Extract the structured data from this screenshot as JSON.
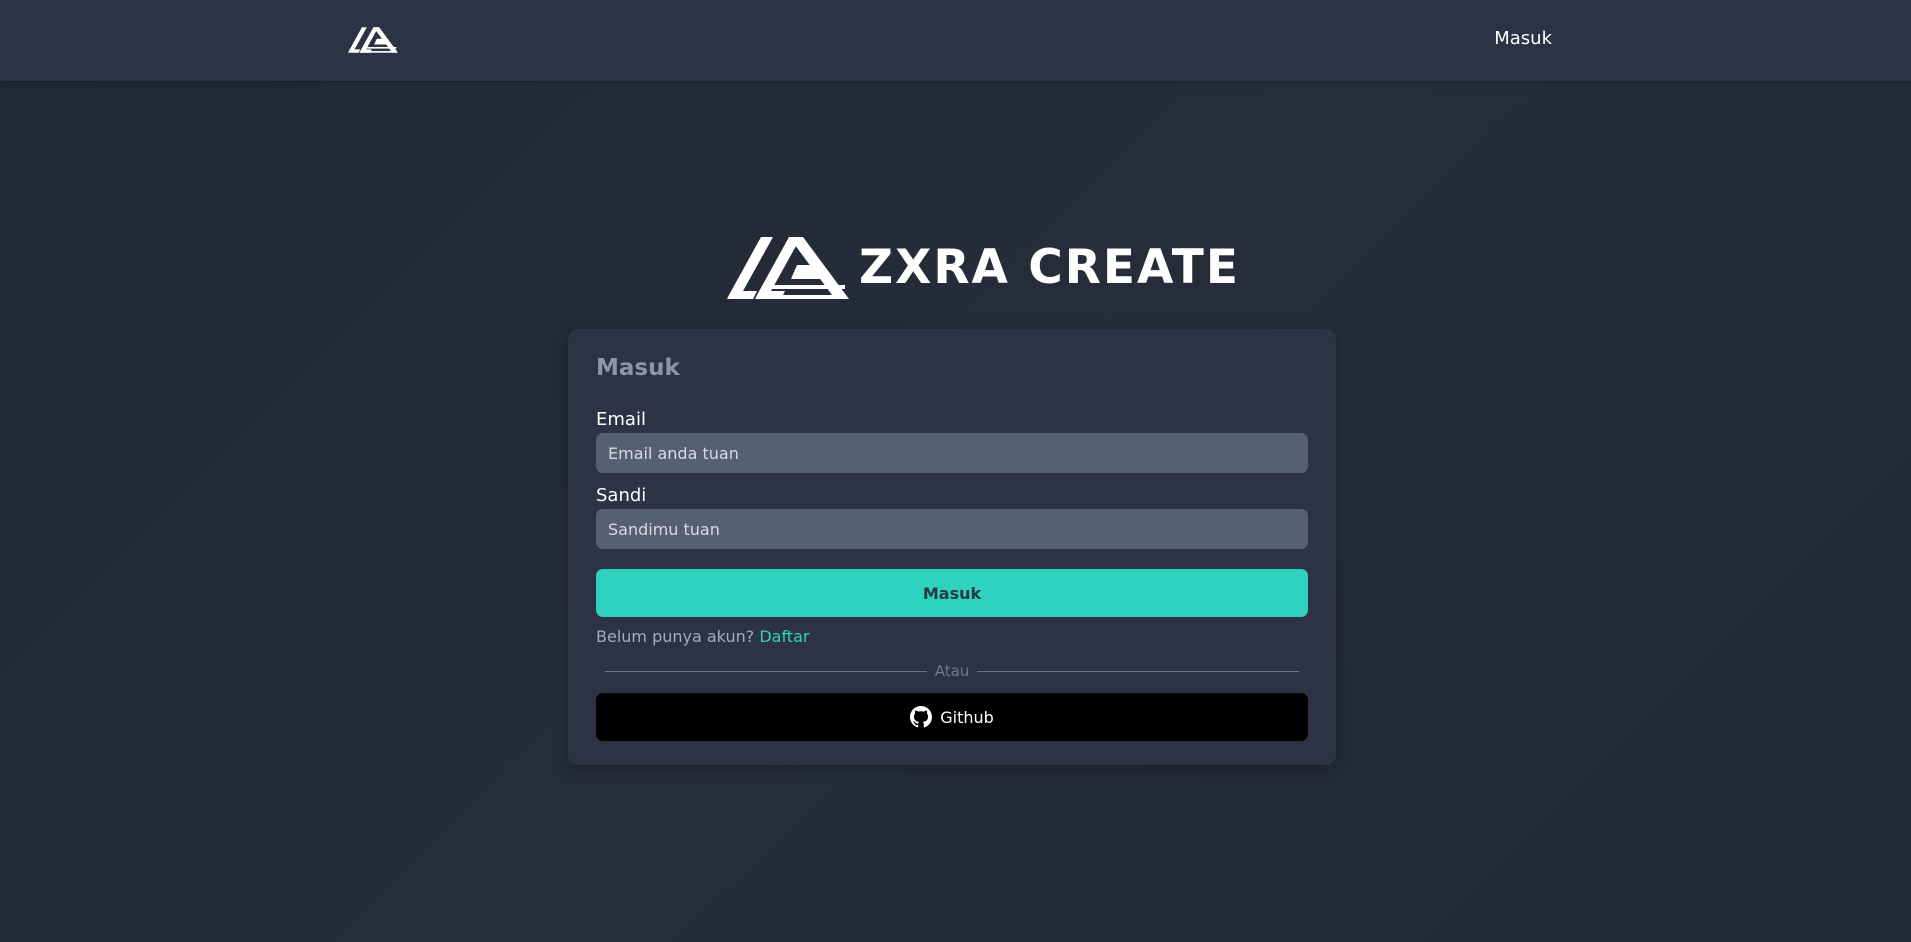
{
  "navbar": {
    "login_label": "Masuk"
  },
  "brand": {
    "name": "ZXRA CREATE"
  },
  "form": {
    "title": "Masuk",
    "email_label": "Email",
    "email_placeholder": "Email anda tuan",
    "email_value": "",
    "password_label": "Sandi",
    "password_placeholder": "Sandimu tuan",
    "password_value": "",
    "submit_label": "Masuk",
    "register_prompt": "Belum punya akun?",
    "register_link": "Daftar",
    "divider_text": "Atau",
    "github_label": "Github"
  },
  "colors": {
    "accent": "#2ed3c0",
    "background": "#232937",
    "navbar": "#2c3345",
    "card": "#2d3344",
    "input": "#556173",
    "github_button": "#000000"
  },
  "icons": {
    "logo": "zxra-logo-icon",
    "github": "github-icon"
  }
}
